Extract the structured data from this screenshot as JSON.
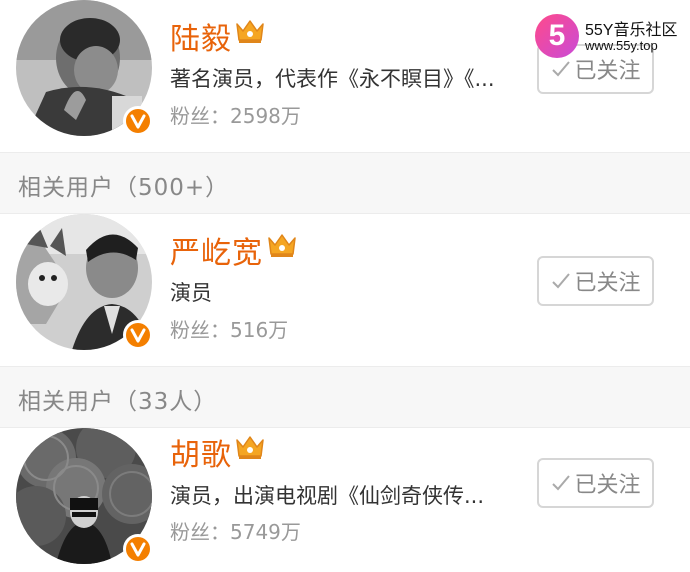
{
  "watermark": {
    "logo": "5",
    "title": "55Y音乐社区",
    "url": "www.55y.top"
  },
  "sections": [
    {
      "label": "相关用户（500+）"
    },
    {
      "label": "相关用户（33人）"
    }
  ],
  "users": [
    {
      "name": "陆毅",
      "description": "著名演员，代表作《永不瞑目》《...",
      "fans": "粉丝：2598万",
      "follow_label": "已关注"
    },
    {
      "name": "严屹宽",
      "description": "演员",
      "fans": "粉丝：516万",
      "follow_label": "已关注"
    },
    {
      "name": "胡歌",
      "description": "演员，出演电视剧《仙剑奇侠传...",
      "fans": "粉丝：5749万",
      "follow_label": "已关注"
    }
  ],
  "colors": {
    "name": "#e8630a",
    "verified_badge": "#f47f00",
    "crown": "#f5a623",
    "section_bg": "#f7f7f7"
  },
  "icons": {
    "verified": "verified-v-icon",
    "crown": "crown-icon",
    "check": "check-icon"
  }
}
